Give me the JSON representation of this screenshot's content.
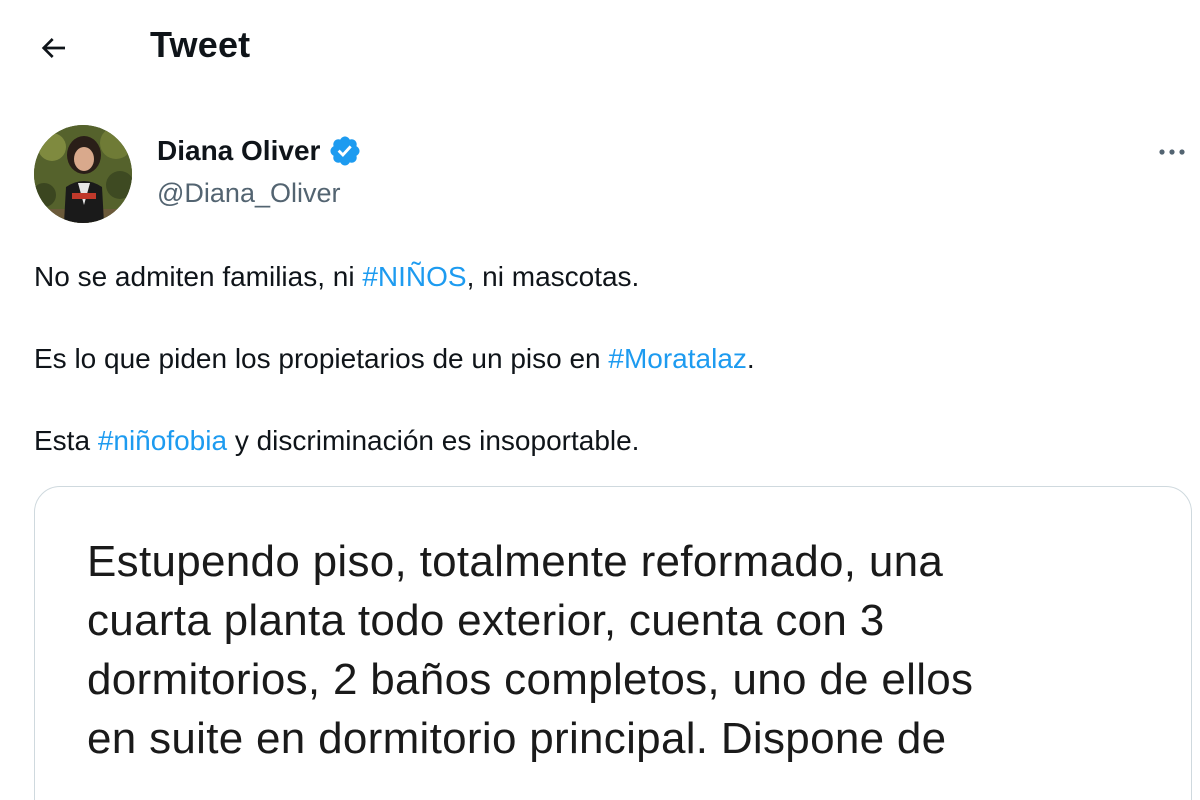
{
  "header": {
    "title": "Tweet"
  },
  "author": {
    "name": "Diana Oliver",
    "handle": "@Diana_Oliver",
    "verified": true
  },
  "icons": {
    "back": "arrow-left-icon",
    "verified": "verified-badge-icon",
    "more": "more-horizontal-icon"
  },
  "colors": {
    "link": "#1d9bf0",
    "text": "#0f1419",
    "secondary": "#536471",
    "verified": "#1d9bf0",
    "border": "#cfd9de"
  },
  "tweet": {
    "p1": {
      "before": "No se admiten familias, ni ",
      "tag": "#NIÑOS",
      "after": ", ni mascotas."
    },
    "p2": {
      "before": "Es lo que piden los propietarios de un piso en ",
      "tag": "#Moratalaz",
      "after": "."
    },
    "p3": {
      "before": "Esta ",
      "tag": "#niñofobia",
      "after": " y discriminación es insoportable."
    }
  },
  "media": {
    "lines": [
      "Estupendo piso, totalmente reformado, una",
      "cuarta planta todo exterior, cuenta con 3",
      "dormitorios, 2 baños completos, uno de ellos",
      "en suite en dormitorio principal. Dispone de"
    ]
  }
}
